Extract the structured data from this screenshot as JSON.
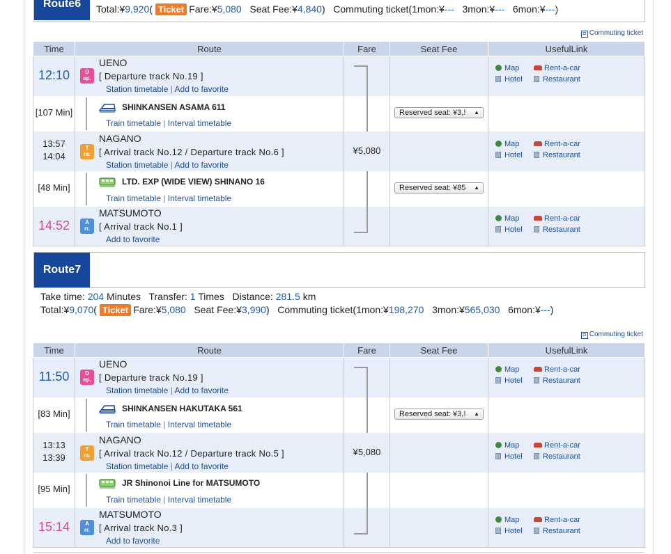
{
  "route6": {
    "tab": "Route6",
    "total_label": "Total:¥",
    "total": "9,920",
    "ticket": "Ticket",
    "fare_label": "Fare:¥",
    "fare": "5,080",
    "seat_label": "Seat Fee:¥",
    "seat": "4,840",
    "commuting_label": "Commuting ticket(1mon:¥",
    "m1": "---",
    "m3_label": "3mon:¥",
    "m3": "---",
    "m6_label": "6mon:¥",
    "m6": "---",
    "commuting_link": "Commuting ticket",
    "headers": [
      "Time",
      "Route",
      "Fare",
      "Seat Fee",
      "UsefulLink"
    ],
    "rows": [
      {
        "kind": "station",
        "time": "12:10",
        "icon": "D\nep.",
        "icon_type": "dep",
        "name": "UENO",
        "track": "[ Departure track No.19 ]",
        "link1": "Station timetable",
        "link2": "Add to favorite"
      },
      {
        "kind": "ride",
        "duration": "[107 Min]",
        "train": "SHINKANSEN ASAMA 611",
        "link1": "Train timetable",
        "link2": "Interval timetable",
        "seat": "Reserved seat: ¥3,!"
      },
      {
        "kind": "station",
        "time_a": "13:57",
        "time_b": "14:04",
        "icon": "T\nra.",
        "icon_type": "tra",
        "name": "NAGANO",
        "track": "[ Arrival track No.12 / Departure track No.6 ]",
        "link1": "Station timetable",
        "link2": "Add to favorite",
        "fare": "¥5,080"
      },
      {
        "kind": "ride",
        "duration": "[48 Min]",
        "train": "LTD. EXP (WIDE VIEW) SHINANO 16",
        "link1": "Train timetable",
        "link2": "Interval timetable",
        "seat": "Reserved seat: ¥85"
      },
      {
        "kind": "station",
        "time": "14:52",
        "icon": "A\nrr.",
        "icon_type": "arr",
        "name": "MATSUMOTO",
        "track": "[ Arrival track No.1 ]",
        "link2": "Add to favorite"
      }
    ]
  },
  "route7": {
    "tab": "Route7",
    "take_time_label": "Take time:",
    "take_time": "204",
    "take_time_unit": "Minutes",
    "transfer_label": "Transfer:",
    "transfer": "1",
    "transfer_unit": "Times",
    "distance_label": "Distance:",
    "distance": "281.5",
    "distance_unit": "km",
    "total_label": "Total:¥",
    "total": "9,070",
    "ticket": "Ticket",
    "fare_label": "Fare:¥",
    "fare": "5,080",
    "seat_label": "Seat Fee:¥",
    "seat": "3,990",
    "commuting_label": "Commuting ticket(1mon:¥",
    "m1": "198,270",
    "m3_label": "3mon:¥",
    "m3": "565,030",
    "m6_label": "6mon:¥",
    "m6": "---",
    "commuting_link": "Commuting ticket",
    "headers": [
      "Time",
      "Route",
      "Fare",
      "Seat Fee",
      "UsefulLink"
    ],
    "rows": [
      {
        "kind": "station",
        "time": "11:50",
        "icon": "D\nep.",
        "icon_type": "dep",
        "name": "UENO",
        "track": "[ Departure track No.19 ]",
        "link1": "Station timetable",
        "link2": "Add to favorite"
      },
      {
        "kind": "ride",
        "duration": "[83 Min]",
        "train": "SHINKANSEN HAKUTAKA 561",
        "link1": "Train timetable",
        "link2": "Interval timetable",
        "seat": "Reserved seat: ¥3,!"
      },
      {
        "kind": "station",
        "time_a": "13:13",
        "time_b": "13:39",
        "icon": "T\nra.",
        "icon_type": "tra",
        "name": "NAGANO",
        "track": "[ Arrival track No.12 / Departure track No.5 ]",
        "link1": "Station timetable",
        "link2": "Add to favorite",
        "fare": "¥5,080"
      },
      {
        "kind": "ride",
        "duration": "[95 Min]",
        "train": "JR Shinonoi Line  for MATSUMOTO",
        "link1": "Train timetable",
        "link2": "Interval timetable"
      },
      {
        "kind": "station",
        "time": "15:14",
        "icon": "A\nrr.",
        "icon_type": "arr",
        "name": "MATSUMOTO",
        "track": "[ Arrival track No.3 ]",
        "link2": "Add to favorite"
      }
    ]
  },
  "useful": {
    "map": "Map",
    "car": "Rent-a-car",
    "hotel": "Hotel",
    "restaurant": "Restaurant"
  },
  "colors": {
    "navy": "#17479a",
    "header": "#c9d6ea",
    "station_bg": "#e7eefa",
    "ticket": "#f07a26",
    "pink": "#e0458f",
    "link": "#1a5db4"
  }
}
